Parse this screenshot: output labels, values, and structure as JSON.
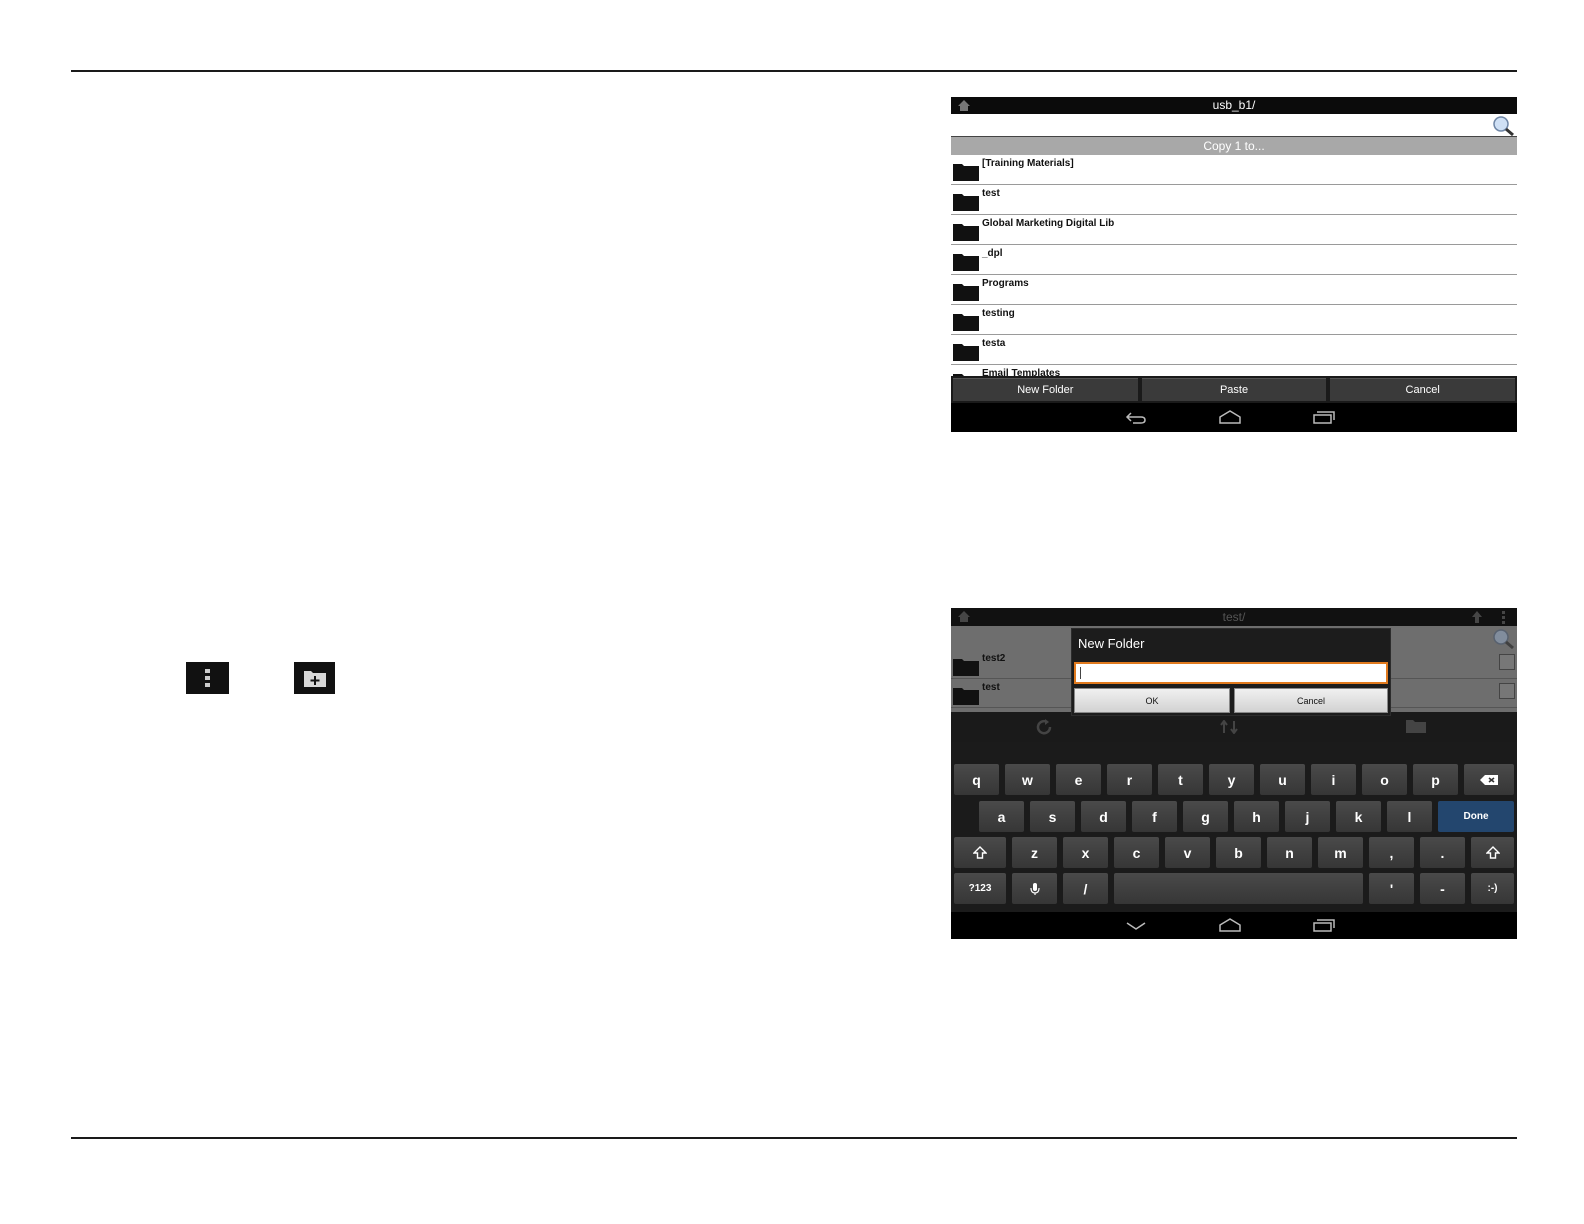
{
  "shot1": {
    "path": "usb_b1/",
    "banner": "Copy 1 to...",
    "folders": [
      "[Training Materials]",
      "test",
      "Global Marketing Digital Lib",
      "_dpl",
      "Programs",
      "testing",
      "testa",
      "Email Templates"
    ],
    "buttons": {
      "new_folder": "New Folder",
      "paste": "Paste",
      "cancel": "Cancel"
    }
  },
  "shot2": {
    "path": "test/",
    "folders": [
      "test2",
      "test"
    ],
    "dialog": {
      "title": "New Folder",
      "value": "",
      "ok": "OK",
      "cancel": "Cancel"
    },
    "keyboard": {
      "row1": [
        "q",
        "w",
        "e",
        "r",
        "t",
        "y",
        "u",
        "i",
        "o",
        "p"
      ],
      "row2": [
        "a",
        "s",
        "d",
        "f",
        "g",
        "h",
        "j",
        "k",
        "l"
      ],
      "row3": [
        "z",
        "x",
        "c",
        "v",
        "b",
        "n",
        "m",
        ",",
        "."
      ],
      "done": "Done",
      "sym": "?123",
      "slash": "/",
      "apos": "'",
      "dash": "-",
      "smiley": ":-)"
    }
  },
  "icons": [
    "more-vertical-icon",
    "new-folder-icon",
    "home-icon",
    "search-icon",
    "folder-icon",
    "back-icon",
    "recent-apps-icon",
    "backspace-icon",
    "shift-icon",
    "mic-icon"
  ],
  "colors": {
    "accent_orange": "#e07a1e",
    "done_blue": "#23466e"
  }
}
